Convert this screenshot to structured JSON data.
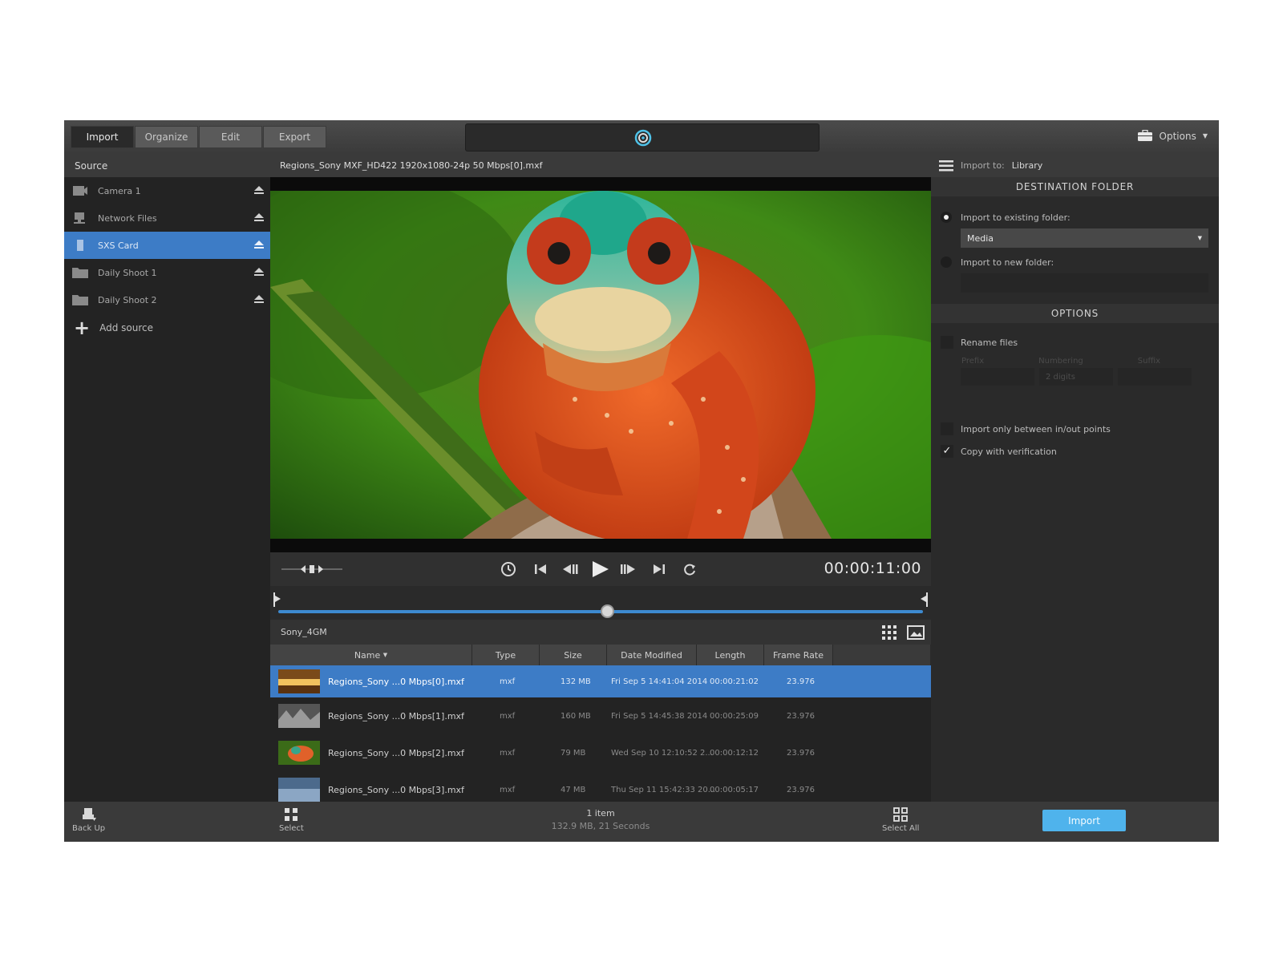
{
  "tabs": [
    {
      "label": "Import",
      "active": true
    },
    {
      "label": "Organize",
      "active": false
    },
    {
      "label": "Edit",
      "active": false
    },
    {
      "label": "Export",
      "active": false
    }
  ],
  "header": {
    "logo_icon": "sony-catalyst-logo-icon",
    "options_label": "Options"
  },
  "sidebar": {
    "title": "Source",
    "items": [
      {
        "label": "Camera 1",
        "icon": "camera-icon",
        "selected": false
      },
      {
        "label": "Network Files",
        "icon": "network-icon",
        "selected": false
      },
      {
        "label": "SXS Card",
        "icon": "card-icon",
        "selected": true
      },
      {
        "label": "Daily Shoot 1",
        "icon": "folder-icon",
        "selected": false
      },
      {
        "label": "Daily Shoot 2",
        "icon": "folder-icon",
        "selected": false
      }
    ],
    "add_source_label": "Add source"
  },
  "viewer": {
    "file_title": "Regions_Sony MXF_HD422 1920x1080-24p 50 Mbps[0].mxf",
    "timecode": "00:00:11:00",
    "playhead_fraction": 0.51
  },
  "browser": {
    "folder": "Sony_4GM",
    "columns": [
      "Name",
      "Type",
      "Size",
      "Date Modified",
      "Length",
      "Frame Rate"
    ],
    "rows": [
      {
        "name": "Regions_Sony ...0 Mbps[0].mxf",
        "type": "mxf",
        "size": "132 MB",
        "date": "Fri Sep 5 14:41:04 2014",
        "length": "00:00:21:02",
        "frame_rate": "23.976",
        "selected": true
      },
      {
        "name": "Regions_Sony ...0 Mbps[1].mxf",
        "type": "mxf",
        "size": "160 MB",
        "date": "Fri Sep 5 14:45:38 2014",
        "length": "00:00:25:09",
        "frame_rate": "23.976",
        "selected": false
      },
      {
        "name": "Regions_Sony ...0 Mbps[2].mxf",
        "type": "mxf",
        "size": "79 MB",
        "date": "Wed Sep 10 12:10:52 2...",
        "length": "00:00:12:12",
        "frame_rate": "23.976",
        "selected": false
      },
      {
        "name": "Regions_Sony ...0 Mbps[3].mxf",
        "type": "mxf",
        "size": "47 MB",
        "date": "Thu Sep 11 15:42:33 20...",
        "length": "00:00:05:17",
        "frame_rate": "23.976",
        "selected": false
      }
    ]
  },
  "right_panel": {
    "import_to_label": "Import to:",
    "import_to_value": "Library",
    "destination_heading": "DESTINATION FOLDER",
    "existing_folder_label": "Import to existing folder:",
    "existing_folder_value": "Media",
    "new_folder_label": "Import to new folder:",
    "options_heading": "OPTIONS",
    "rename_label": "Rename files",
    "prefix_label": "Prefix",
    "numbering_label": "Numbering",
    "suffix_label": "Suffix",
    "numbering_value": "2 digits",
    "inout_label": "Import only between in/out points",
    "verify_label": "Copy with verification",
    "verify_checked": true
  },
  "bottom": {
    "backup_label": "Back Up",
    "select_label": "Select",
    "item_count": "1 item",
    "item_size": "132.9 MB, 21 Seconds",
    "select_all_label": "Select All",
    "import_label": "Import"
  },
  "colors": {
    "accent": "#3d7cc6",
    "import_button": "#4fb3ec"
  }
}
